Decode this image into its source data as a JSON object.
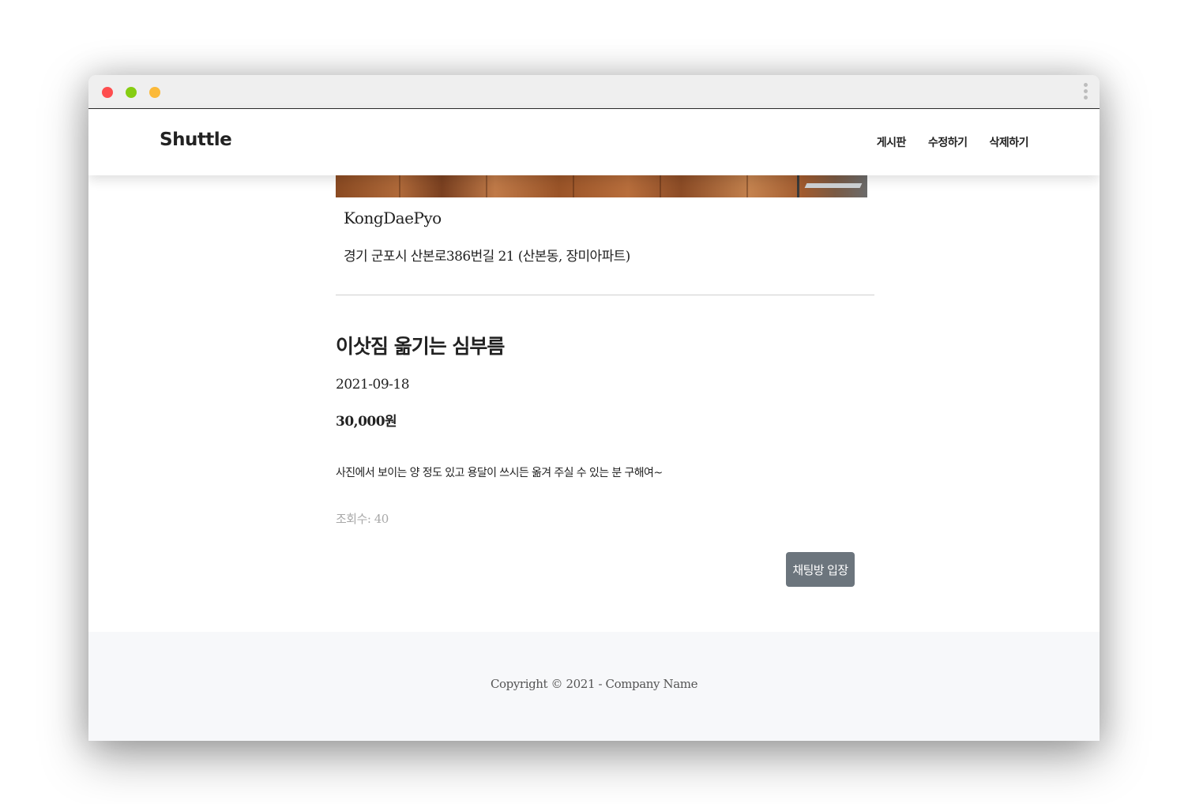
{
  "window": {
    "controls": {
      "close_color": "#fe4d4e",
      "minimize_color": "#86cd12",
      "maximize_color": "#fbb939"
    },
    "menu_icon": "kebab-menu-icon"
  },
  "navbar": {
    "brand": "Shuttle",
    "links": [
      {
        "label": "게시판"
      },
      {
        "label": "수정하기"
      },
      {
        "label": "삭제하기"
      }
    ]
  },
  "post": {
    "author": "KongDaePyo",
    "address": "경기 군포시 산본로386번길 21 (산본동, 장미아파트)",
    "title": "이삿짐 옮기는 심부름",
    "date": "2021-09-18",
    "price": "30,000원",
    "body": "사진에서 보이는 양 정도 있고 용달이 쓰시든 옮겨 주실 수 있는 분 구해여~",
    "views": "조회수: 40",
    "chat_button": "채팅방 입장",
    "button_color": "#6c757d"
  },
  "footer": {
    "copyright": "Copyright © 2021 - Company Name"
  }
}
